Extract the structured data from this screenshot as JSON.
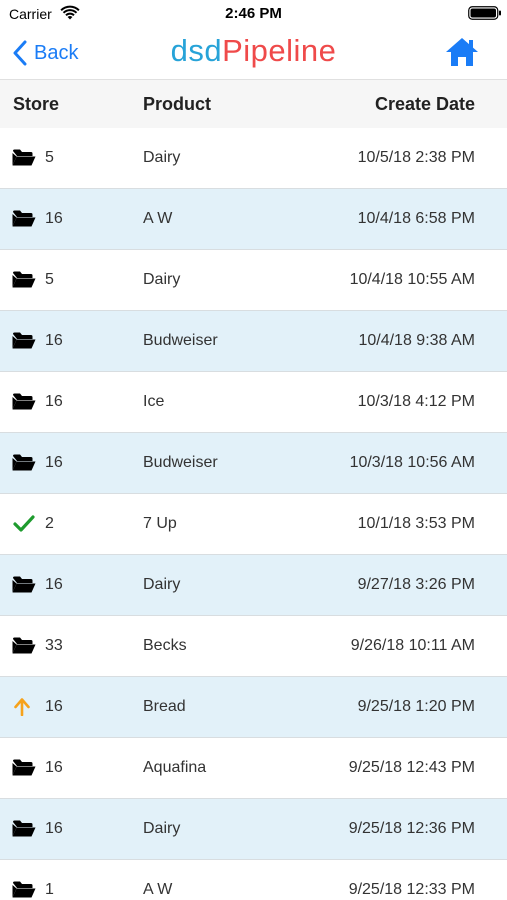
{
  "status_bar": {
    "carrier": "Carrier",
    "time": "2:46 PM"
  },
  "nav": {
    "back_label": "Back",
    "brand_part1": "dsd",
    "brand_part2": "Pipeline",
    "home_icon": "home-icon"
  },
  "colors": {
    "accent": "#1a7cf6",
    "brand_blue": "#27a3d8",
    "brand_red": "#ef4a4a",
    "row_alt": "#e2f1f9",
    "check_green": "#1e9b2e",
    "upload_orange": "#f6a21b"
  },
  "table": {
    "headers": {
      "store": "Store",
      "product": "Product",
      "date": "Create Date"
    },
    "rows": [
      {
        "icon": "folder-icon",
        "store": "5",
        "product": "Dairy",
        "date": "10/5/18 2:38 PM"
      },
      {
        "icon": "folder-icon",
        "store": "16",
        "product": "A W",
        "date": "10/4/18 6:58 PM"
      },
      {
        "icon": "folder-icon",
        "store": "5",
        "product": "Dairy",
        "date": "10/4/18 10:55 AM"
      },
      {
        "icon": "folder-icon",
        "store": "16",
        "product": "Budweiser",
        "date": "10/4/18 9:38 AM"
      },
      {
        "icon": "folder-icon",
        "store": "16",
        "product": "Ice",
        "date": "10/3/18 4:12 PM"
      },
      {
        "icon": "folder-icon",
        "store": "16",
        "product": "Budweiser",
        "date": "10/3/18 10:56 AM"
      },
      {
        "icon": "check-icon",
        "store": "2",
        "product": "7 Up",
        "date": "10/1/18 3:53 PM"
      },
      {
        "icon": "folder-icon",
        "store": "16",
        "product": "Dairy",
        "date": "9/27/18 3:26 PM"
      },
      {
        "icon": "folder-icon",
        "store": "33",
        "product": "Becks",
        "date": "9/26/18 10:11 AM"
      },
      {
        "icon": "upload-arrow-icon",
        "store": "16",
        "product": "Bread",
        "date": "9/25/18 1:20 PM"
      },
      {
        "icon": "folder-icon",
        "store": "16",
        "product": "Aquafina",
        "date": "9/25/18 12:43 PM"
      },
      {
        "icon": "folder-icon",
        "store": "16",
        "product": "Dairy",
        "date": "9/25/18 12:36 PM"
      },
      {
        "icon": "folder-icon",
        "store": "1",
        "product": "A W",
        "date": "9/25/18 12:33 PM"
      }
    ]
  }
}
